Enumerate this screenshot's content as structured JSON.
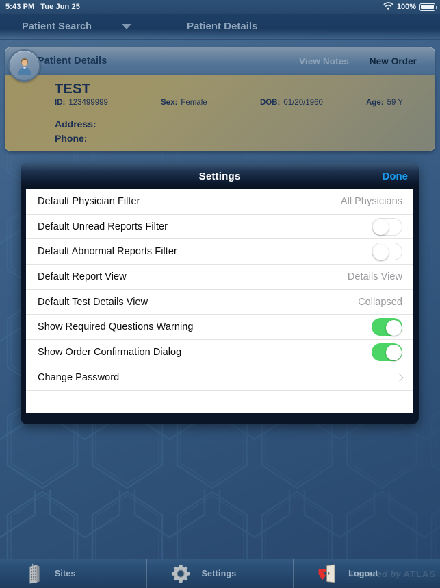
{
  "status_bar": {
    "time": "5:43 PM",
    "date": "Tue Jun 25",
    "wifi_icon": "wifi-icon",
    "battery_percent": "100%",
    "battery_icon": "battery-full-icon"
  },
  "nav_bar": {
    "back_crumb": "Patient Search",
    "dropdown_icon": "chevron-down-icon",
    "title": "Patient Details"
  },
  "patient_panel": {
    "avatar_icon": "patient-avatar-icon",
    "header_title": "Patient Details",
    "view_notes_label": "View Notes",
    "new_order_label": "New Order",
    "name": "TEST",
    "fields": [
      {
        "label": "ID:",
        "value": "123499999"
      },
      {
        "label": "Sex:",
        "value": "Female"
      },
      {
        "label": "DOB:",
        "value": "01/20/1960"
      },
      {
        "label": "Age:",
        "value": "59 Y"
      }
    ],
    "address_label": "Address:",
    "address_value": "",
    "phone_label": "Phone:",
    "phone_value": ""
  },
  "settings_modal": {
    "title": "Settings",
    "done_label": "Done",
    "done_color": "#1a9bf0",
    "toggle_on_color": "#4bd564",
    "rows": [
      {
        "label": "Default Physician Filter",
        "type": "value",
        "value": "All Physicians"
      },
      {
        "label": "Default Unread Reports Filter",
        "type": "toggle",
        "state": "off"
      },
      {
        "label": "Default Abnormal Reports Filter",
        "type": "toggle",
        "state": "off"
      },
      {
        "label": "Default Report View",
        "type": "value",
        "value": "Details View"
      },
      {
        "label": "Default Test Details View",
        "type": "value",
        "value": "Collapsed"
      },
      {
        "label": "Show Required Questions Warning",
        "type": "toggle",
        "state": "on"
      },
      {
        "label": "Show Order Confirmation Dialog",
        "type": "toggle",
        "state": "on"
      },
      {
        "label": "Change Password",
        "type": "disclosure",
        "icon": "chevron-right-icon"
      }
    ]
  },
  "tab_bar": {
    "tabs": [
      {
        "label": "Sites",
        "icon": "building-icon"
      },
      {
        "label": "Settings",
        "icon": "gear-icon"
      },
      {
        "label": "Logout",
        "icon": "logout-door-icon"
      }
    ]
  },
  "watermark": {
    "prefix": "Powered by ",
    "brand": "ATLAS"
  }
}
